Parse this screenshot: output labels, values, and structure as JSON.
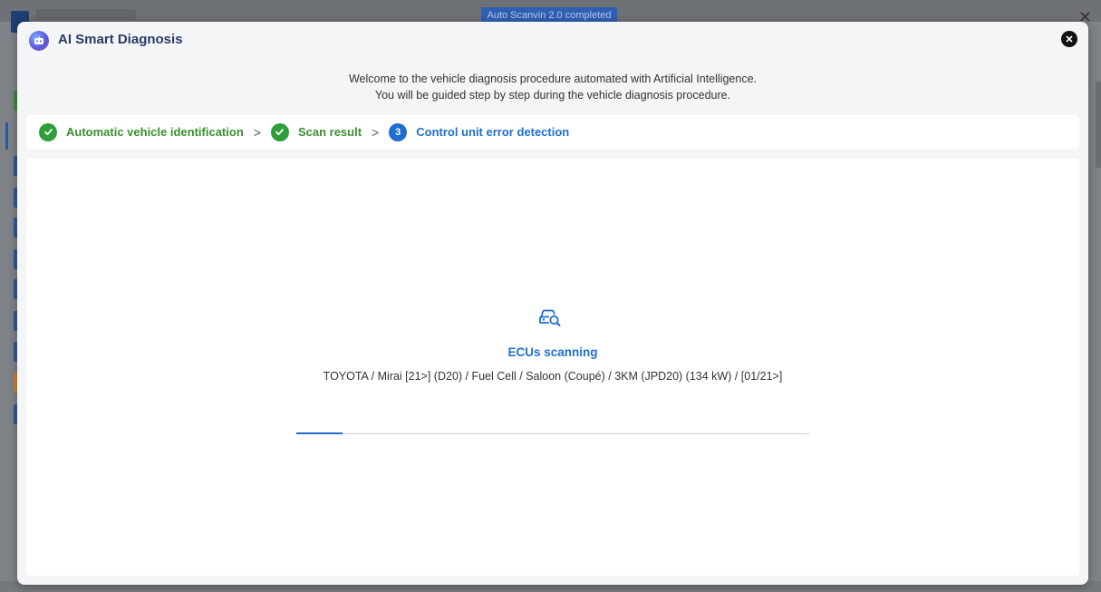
{
  "background": {
    "toast_text": "Auto Scanvin 2.0 completed",
    "close_glyph": "✕"
  },
  "modal": {
    "title": "AI Smart Diagnosis",
    "icon": "ai-assistant-icon",
    "close_icon": "close-icon"
  },
  "intro": {
    "line1": "Welcome to the vehicle diagnosis procedure automated with Artificial Intelligence.",
    "line2": "You will be guided step by step during the vehicle diagnosis procedure."
  },
  "stepper": {
    "steps": [
      {
        "label": "Automatic vehicle identification",
        "state": "done"
      },
      {
        "label": "Scan result",
        "state": "done"
      },
      {
        "label": "Control unit error detection",
        "state": "active",
        "number": "3"
      }
    ],
    "separator": ">"
  },
  "scan": {
    "icon": "car-search-icon",
    "title": "ECUs scanning",
    "vehicle": "TOYOTA / Mirai [21>] (D20) / Fuel Cell / Saloon (Coupé) / 3KM (JPD20) (134 kW) / [01/21>]",
    "progress_fraction": 0.09
  },
  "colors": {
    "accent_blue": "#1e6fd0",
    "success_green": "#2e9e3a"
  }
}
